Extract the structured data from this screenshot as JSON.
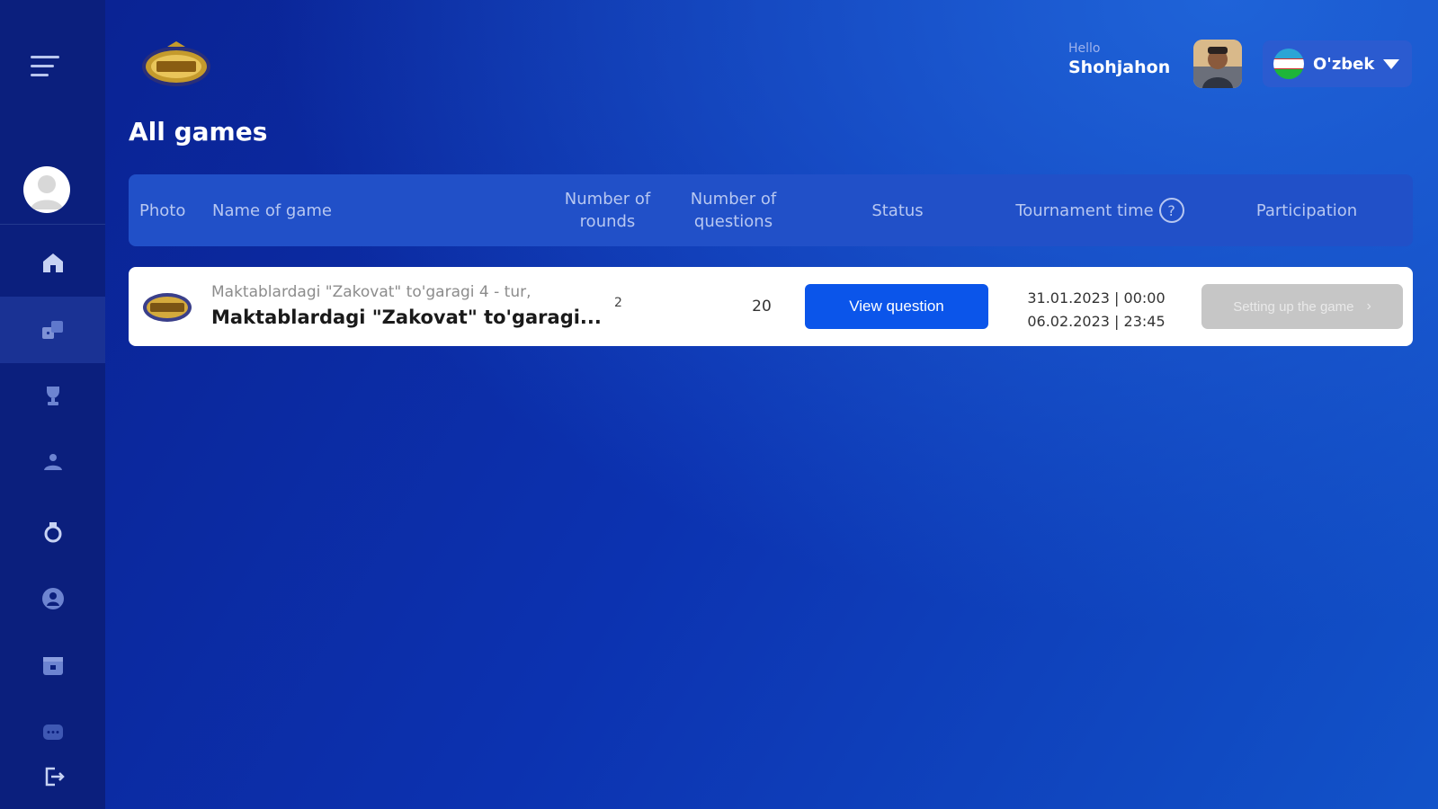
{
  "header": {
    "hello": "Hello",
    "username": "Shohjahon",
    "language": "O'zbek"
  },
  "page": {
    "title": "All games"
  },
  "table": {
    "columns": {
      "photo": "Photo",
      "name": "Name of game",
      "rounds_line1": "Number of",
      "rounds_line2": "rounds",
      "questions_line1": "Number of",
      "questions_line2": "questions",
      "status": "Status",
      "time": "Tournament time",
      "participation": "Participation"
    },
    "rows": [
      {
        "subtitle": "Maktablardagi \"Zakovat\" to'garagi 4 - tur,",
        "name": "Maktablardagi \"Zakovat\" to'garagi...",
        "rounds": "2",
        "questions": "20",
        "status_label": "View question",
        "time_start": "31.01.2023 | 00:00",
        "time_end": "06.02.2023 | 23:45",
        "participation_label": "Setting up the game"
      }
    ]
  },
  "colors": {
    "sidebar": "#0b1f7d",
    "accent": "#0b55ea",
    "header_row": "#2150c8"
  }
}
